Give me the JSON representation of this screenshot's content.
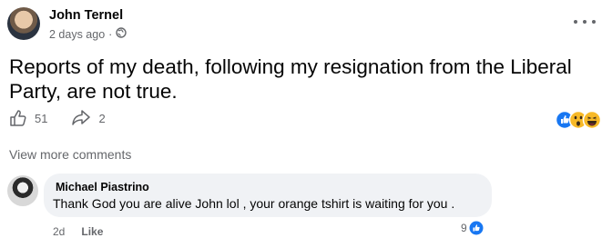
{
  "post": {
    "author": "John Ternel",
    "time": "2 days ago",
    "separator": "·",
    "privacy_icon": "globe-icon",
    "text": "Reports of my death, following my resignation from the Liberal Party, are not true.",
    "like_count": "51",
    "share_count": "2",
    "reaction_icons": [
      "like-icon",
      "wow-icon",
      "haha-icon"
    ]
  },
  "comments": {
    "view_more": "View more comments",
    "items": [
      {
        "author": "Michael Piastrino",
        "text": "Thank God you are alive John lol , your orange tshirt is waiting for you .",
        "age": "2d",
        "like_label": "Like",
        "reaction_count": "9"
      }
    ]
  },
  "colors": {
    "text": "#050505",
    "secondary": "#65676b",
    "bubble": "#f0f2f5",
    "like_blue": "#1877f2",
    "emoji_yellow": "#f7b928"
  }
}
